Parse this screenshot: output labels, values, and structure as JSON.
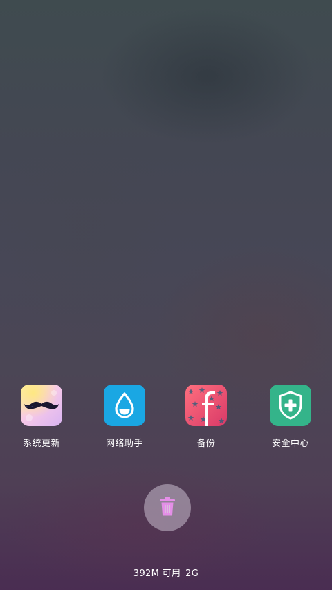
{
  "recent_apps": [
    {
      "label": "系统更新",
      "icon": "mustache-icon"
    },
    {
      "label": "网络助手",
      "icon": "water-drop-icon"
    },
    {
      "label": "备份",
      "icon": "facebook-icon"
    },
    {
      "label": "安全中心",
      "icon": "shield-plus-icon"
    }
  ],
  "clear_button": {
    "icon": "trash-icon",
    "color": "#e48fe7"
  },
  "memory_status": {
    "available": "392M 可用",
    "total": "2G"
  },
  "colors": {
    "network_icon_bg": "#1aa7e3",
    "security_icon_bg": "#34b48a",
    "backup_icon_bg": "#e8506e"
  }
}
